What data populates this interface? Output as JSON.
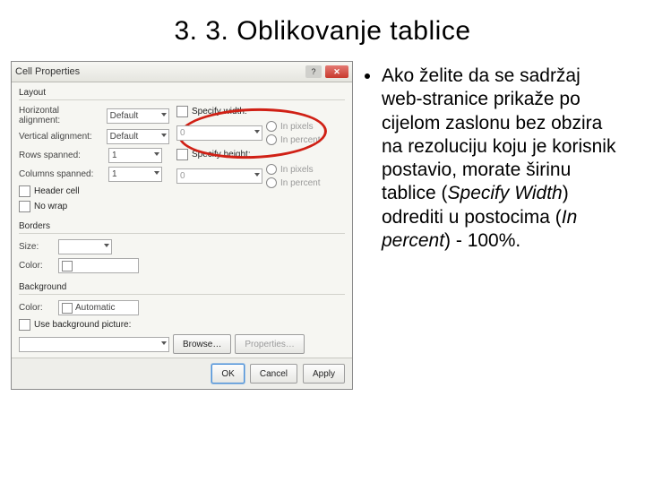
{
  "title": "3. 3. Oblikovanje tablice",
  "body_html": "Ako želite da se sadržaj web-stranice prikaže po cijelom zaslonu bez obzira na rezoluciju koju je korisnik postavio, morate širinu tablice (<i>Specify Width</i>) odrediti u postocima (<i>In percent</i>) - 100%.",
  "body_plain": "Ako želite da se sadržaj web-stranice prikaže po cijelom zaslonu bez obzira na rezoluciju koju je korisnik postavio, morate širinu tablice (Specify Width) odrediti u postocima (In percent) - 100%.",
  "dialog": {
    "title": "Cell Properties",
    "sections": {
      "layout": "Layout",
      "borders": "Borders",
      "background": "Background"
    },
    "labels": {
      "halign": "Horizontal alignment:",
      "valign": "Vertical alignment:",
      "rows": "Rows spanned:",
      "cols": "Columns spanned:",
      "header": "Header cell",
      "nowrap": "No wrap",
      "specwidth": "Specify width:",
      "specheight": "Specify height:",
      "inpixels": "In pixels",
      "inpercent": "In percent",
      "size": "Size:",
      "color": "Color:",
      "bgcolor": "Color:",
      "usebg": "Use background picture:",
      "browse": "Browse…",
      "properties": "Properties…"
    },
    "values": {
      "halign": "Default",
      "valign": "Default",
      "rows": "1",
      "cols": "1",
      "width_val": "0",
      "height_val": "0",
      "size": "",
      "colorbtn": "Automatic"
    },
    "buttons": {
      "ok": "OK",
      "cancel": "Cancel",
      "apply": "Apply"
    }
  }
}
